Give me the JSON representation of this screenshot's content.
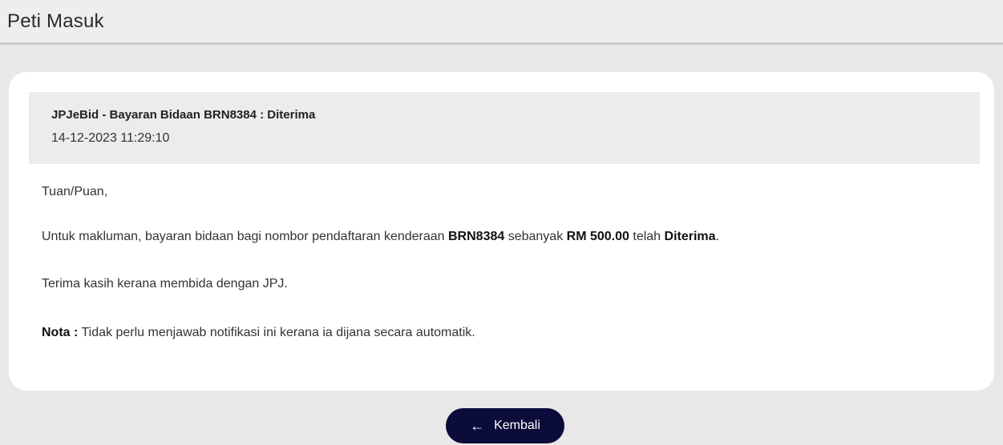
{
  "header": {
    "title": "Peti Masuk"
  },
  "message": {
    "subject": "JPJeBid - Bayaran Bidaan BRN8384 : Diterima",
    "datetime": "14-12-2023 11:29:10",
    "greeting": "Tuan/Puan,",
    "line1_prefix": "Untuk makluman, bayaran bidaan bagi nombor pendaftaran kenderaan ",
    "plate": "BRN8384",
    "line1_mid": " sebanyak ",
    "amount": "RM 500.00",
    "line1_mid2": " telah ",
    "status": "Diterima",
    "line1_suffix": ".",
    "thanks": "Terima kasih kerana membida dengan JPJ.",
    "note_label": "Nota :",
    "note_text": " Tidak perlu menjawab notifikasi ini kerana ia dijana secara automatik."
  },
  "actions": {
    "back_icon": "arrow-left-icon",
    "back_label": "Kembali"
  }
}
